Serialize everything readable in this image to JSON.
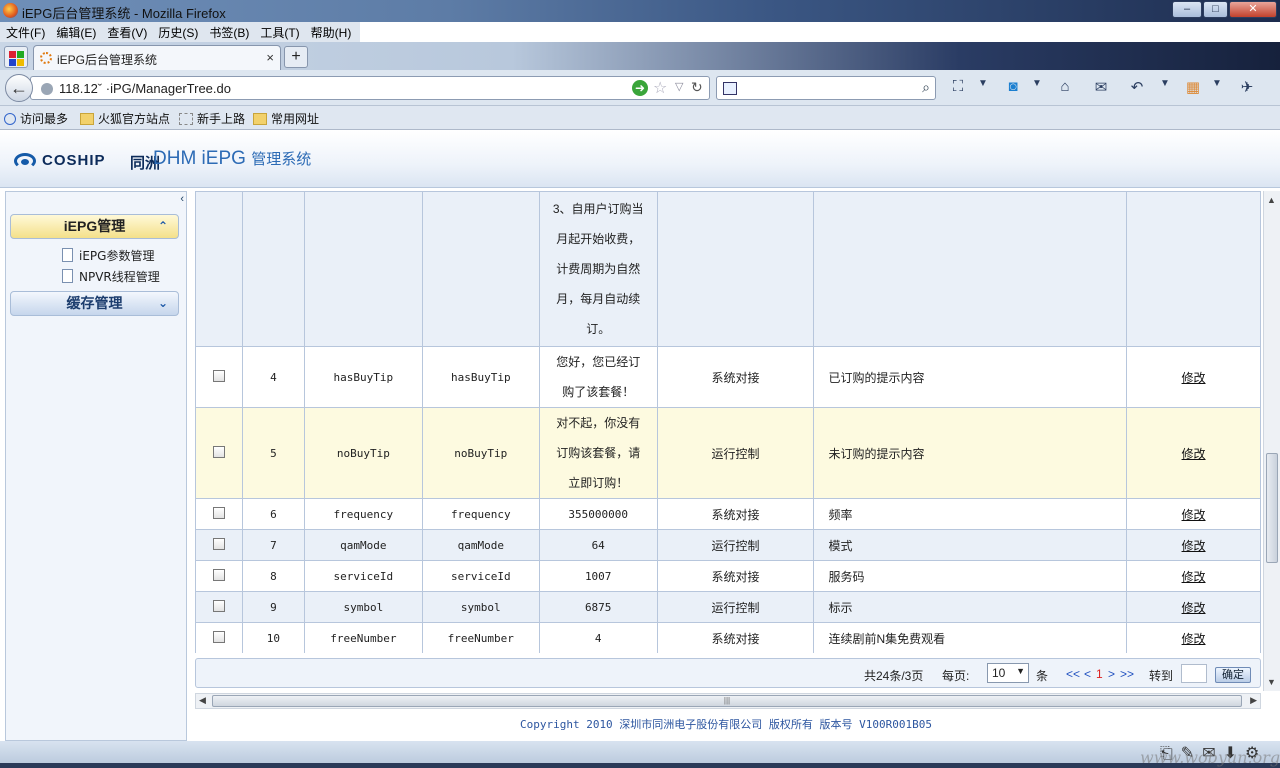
{
  "window": {
    "title": "iEPG后台管理系统 - Mozilla Firefox",
    "controls": [
      "–",
      "□",
      "✕"
    ]
  },
  "menubar": [
    "文件(F)",
    "编辑(E)",
    "查看(V)",
    "历史(S)",
    "书签(B)",
    "工具(T)",
    "帮助(H)"
  ],
  "tab": {
    "title": "iEPG后台管理系统",
    "close": "×",
    "new_tab": "+"
  },
  "navbar": {
    "url": "118.12ˇ          ·iPG/ManagerTree.do",
    "search_value": ""
  },
  "bookmarks": [
    "访问最多",
    "火狐官方站点",
    "新手上路",
    "常用网址"
  ],
  "app": {
    "logo_text": "COSHIP",
    "logo_cn": "同洲",
    "name": "DHM iEPG",
    "name_suffix": "管理系统"
  },
  "sidebar": {
    "collapse": "‹",
    "groups": [
      {
        "label": "iEPG管理",
        "chevron": "⌃",
        "items": [
          "iEPG参数管理",
          "NPVR线程管理"
        ]
      },
      {
        "label": "缓存管理",
        "chevron": "⌄",
        "items": []
      }
    ]
  },
  "table": {
    "top_partial_value": [
      "3、自用户订购当",
      "月起开始收费，",
      "计费周期为自然",
      "月，每月自动续",
      "订。"
    ],
    "rows": [
      {
        "no": "4",
        "key": "hasBuyTip",
        "name": "hasBuyTip",
        "value": [
          "您好，您已经订",
          "购了该套餐！"
        ],
        "type": "系统对接",
        "desc": "已订购的提示内容",
        "action": "修改"
      },
      {
        "no": "5",
        "key": "noBuyTip",
        "name": "noBuyTip",
        "value": [
          "对不起，你没有",
          "订购该套餐，请",
          "立即订购！"
        ],
        "type": "运行控制",
        "desc": "未订购的提示内容",
        "action": "修改"
      },
      {
        "no": "6",
        "key": "frequency",
        "name": "frequency",
        "value": [
          "355000000"
        ],
        "type": "系统对接",
        "desc": "频率",
        "action": "修改"
      },
      {
        "no": "7",
        "key": "qamMode",
        "name": "qamMode",
        "value": [
          "64"
        ],
        "type": "运行控制",
        "desc": "模式",
        "action": "修改"
      },
      {
        "no": "8",
        "key": "serviceId",
        "name": "serviceId",
        "value": [
          "1007"
        ],
        "type": "系统对接",
        "desc": "服务码",
        "action": "修改"
      },
      {
        "no": "9",
        "key": "symbol",
        "name": "symbol",
        "value": [
          "6875"
        ],
        "type": "运行控制",
        "desc": "标示",
        "action": "修改"
      },
      {
        "no": "10",
        "key": "freeNumber",
        "name": "freeNumber",
        "value": [
          "4"
        ],
        "type": "系统对接",
        "desc": "连续剧前N集免费观看",
        "action": "修改"
      }
    ]
  },
  "pager": {
    "summary": "共24条/3页",
    "per_page_label": "每页:",
    "per_page_value": "10",
    "per_page_unit": "条",
    "first": "<<",
    "prev": "<",
    "current": "1",
    "next": ">",
    "last": ">>",
    "goto_label": "转到",
    "goto_value": "",
    "ok": "确定"
  },
  "footer": "Copyright 2010 深圳市同洲电子股份有限公司 版权所有 版本号 V100R001B05",
  "watermark": "www.wobyun.org"
}
